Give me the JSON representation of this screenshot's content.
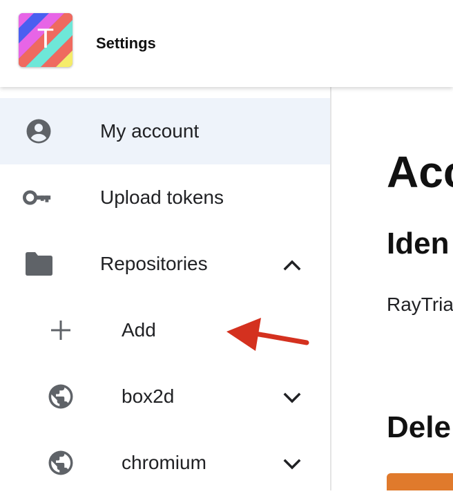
{
  "app": {
    "title": "Settings",
    "logo_letter": "T"
  },
  "sidebar": {
    "items": [
      {
        "label": "My account",
        "icon": "account-circle-icon",
        "active": true
      },
      {
        "label": "Upload tokens",
        "icon": "key-icon"
      },
      {
        "label": "Repositories",
        "icon": "folder-icon",
        "expanded": true,
        "chevron": "chevron-up-icon"
      }
    ],
    "repositories": [
      {
        "label": "Add",
        "icon": "plus-icon"
      },
      {
        "label": "box2d",
        "icon": "globe-icon",
        "chevron": "chevron-down-icon"
      },
      {
        "label": "chromium",
        "icon": "globe-icon",
        "chevron": "chevron-down-icon"
      }
    ]
  },
  "main": {
    "heading": "Acc",
    "identity_heading": "Iden",
    "username": "RayTria",
    "delete_heading": "Dele"
  },
  "colors": {
    "active_bg": "#eef3fa",
    "accent_orange": "#e07a2c",
    "arrow_red": "#d4311f",
    "icon_gray": "#5f6368"
  }
}
